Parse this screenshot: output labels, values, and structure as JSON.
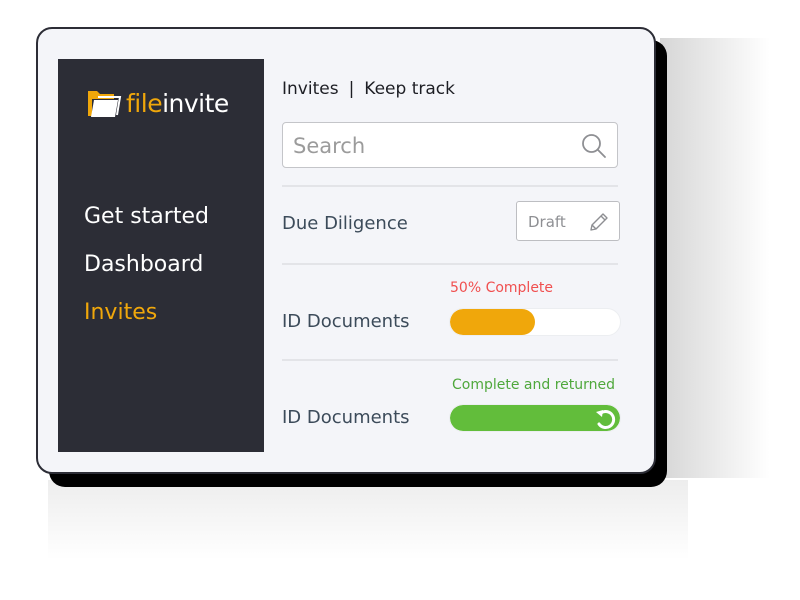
{
  "brand": {
    "name_part1": "file",
    "name_part2": "invite",
    "logo_icon": "folder-icon",
    "accent_color": "#f0a70b"
  },
  "sidebar": {
    "items": [
      {
        "label": "Get started",
        "active": false
      },
      {
        "label": "Dashboard",
        "active": false
      },
      {
        "label": "Invites",
        "active": true
      }
    ]
  },
  "header": {
    "title": "Invites",
    "separator": "|",
    "subtitle": "Keep track"
  },
  "search": {
    "placeholder": "Search",
    "value": "",
    "icon": "search-icon"
  },
  "rows": [
    {
      "label": "Due Diligence",
      "action": {
        "label": "Draft",
        "icon": "pencil-icon"
      }
    },
    {
      "label": "ID Documents",
      "status_text": "50% Complete",
      "status_color": "#f04f4f",
      "progress": 0.5,
      "bar_color": "#f0a70b"
    },
    {
      "label": "ID Documents",
      "status_text": "Complete and returned",
      "status_color": "#4fa83c",
      "progress": 1.0,
      "bar_color": "#62bd3b",
      "icon": "return-arrow-icon"
    }
  ]
}
